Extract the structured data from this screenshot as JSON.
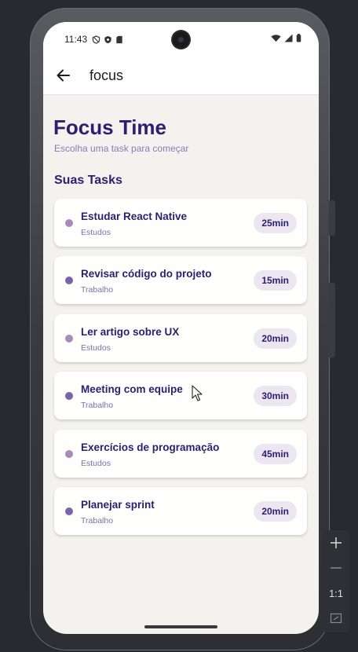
{
  "status_bar": {
    "time": "11:43"
  },
  "app_bar": {
    "title": "focus"
  },
  "page": {
    "title": "Focus Time",
    "subtitle": "Escolha uma task para começar",
    "section_title": "Suas Tasks"
  },
  "tasks": [
    {
      "name": "Estudar React Native",
      "category": "Estudos",
      "duration": "25min",
      "dot_color": "#a98bb8"
    },
    {
      "name": "Revisar código do projeto",
      "category": "Trabalho",
      "duration": "15min",
      "dot_color": "#7a63a8"
    },
    {
      "name": "Ler artigo sobre UX",
      "category": "Estudos",
      "duration": "20min",
      "dot_color": "#a98bb8"
    },
    {
      "name": "Meeting com equipe",
      "category": "Trabalho",
      "duration": "30min",
      "dot_color": "#7a63a8"
    },
    {
      "name": "Exercícios de programação",
      "category": "Estudos",
      "duration": "45min",
      "dot_color": "#a98bb8"
    },
    {
      "name": "Planejar sprint",
      "category": "Trabalho",
      "duration": "20min",
      "dot_color": "#7a63a8"
    }
  ],
  "zoom_controls": {
    "zoom_in": "+",
    "zoom_out": "−",
    "reset_label": "1:1"
  },
  "colors": {
    "primary_text": "#2b1f6e",
    "secondary_text": "#8a7bb5",
    "background": "#f3f2ee",
    "badge_bg": "#ebe6f0"
  }
}
